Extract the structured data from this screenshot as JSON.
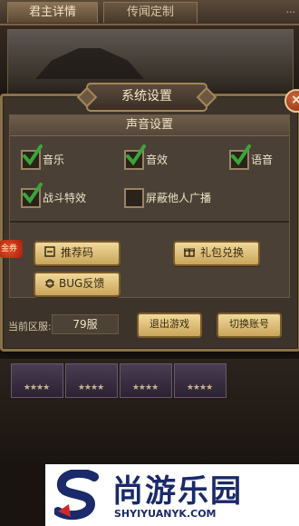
{
  "tabs": [
    {
      "label": "君主详情"
    },
    {
      "label": "传闻定制"
    }
  ],
  "top_right_text": "...",
  "dialog": {
    "title": "系统设置",
    "close_label": "×",
    "sound_section": {
      "title": "声音设置",
      "options": [
        {
          "label": "音乐",
          "checked": true
        },
        {
          "label": "音效",
          "checked": true
        },
        {
          "label": "语音",
          "checked": true
        },
        {
          "label": "战斗特效",
          "checked": true
        },
        {
          "label": "屏蔽他人广播",
          "checked": false
        }
      ]
    },
    "buttons": {
      "referral": "推荐码",
      "gift_redeem": "礼包兑换",
      "bug_feedback": "BUG反馈"
    },
    "badge": "金券",
    "footer": {
      "server_label": "当前区服:",
      "server_value": "79服",
      "exit_label": "退出游戏",
      "switch_label": "切换账号"
    }
  },
  "hero_stars": "★★★★",
  "watermark": {
    "title": "尚游乐园",
    "url": "SHYIYUANYK.COM"
  },
  "colors": {
    "accent_gold": "#c9a55a",
    "check_green": "#3aa63a",
    "panel_bg": "#3c332a",
    "watermark_blue": "#1a2a6a"
  }
}
